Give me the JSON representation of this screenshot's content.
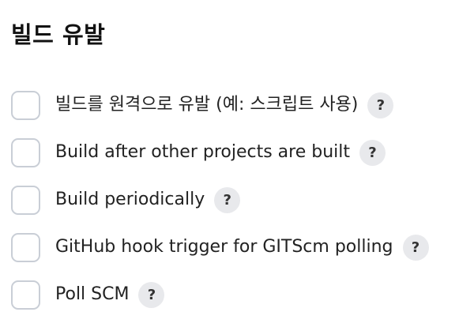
{
  "section": {
    "title": "빌드 유발"
  },
  "help_icon_glyph": "?",
  "options": [
    {
      "label": "빌드를 원격으로 유발 (예: 스크립트 사용)",
      "checked": false
    },
    {
      "label": "Build after other projects are built",
      "checked": false
    },
    {
      "label": "Build periodically",
      "checked": false
    },
    {
      "label": "GitHub hook trigger for GITScm polling",
      "checked": false
    },
    {
      "label": "Poll SCM",
      "checked": false
    }
  ],
  "colors": {
    "checkbox_border": "#c9ced6",
    "help_bg": "#e8e9ec",
    "text": "#222222"
  },
  "icons": {
    "help": "help-icon"
  }
}
